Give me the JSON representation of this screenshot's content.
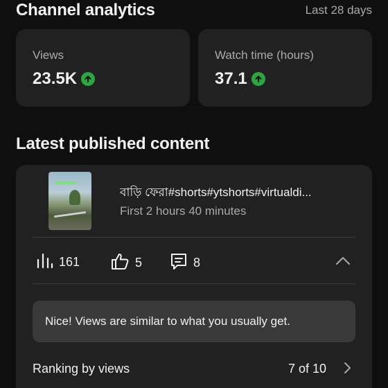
{
  "analytics": {
    "title": "Channel analytics",
    "period": "Last 28 days",
    "cards": [
      {
        "label": "Views",
        "value": "23.5K",
        "trend_icon": "arrow-up-circle-icon"
      },
      {
        "label": "Watch time (hours)",
        "value": "37.1",
        "trend_icon": "arrow-up-circle-icon"
      }
    ]
  },
  "latest": {
    "heading": "Latest published content",
    "video": {
      "title": "বাড়ি ফেরা#shorts#ytshorts#virtualdi...",
      "meta": "First 2 hours 40 minutes"
    },
    "metrics": {
      "views": "161",
      "likes": "5",
      "comments": "8"
    },
    "insight": "Nice! Views are similar to what you usually get.",
    "ranking": {
      "label": "Ranking by views",
      "value": "7 of 10"
    }
  },
  "colors": {
    "background": "#0f0f0f",
    "card": "#212121",
    "insight": "#3a3a3a",
    "trend_up": "#2ba640",
    "secondary_text": "#aaaaaa"
  }
}
